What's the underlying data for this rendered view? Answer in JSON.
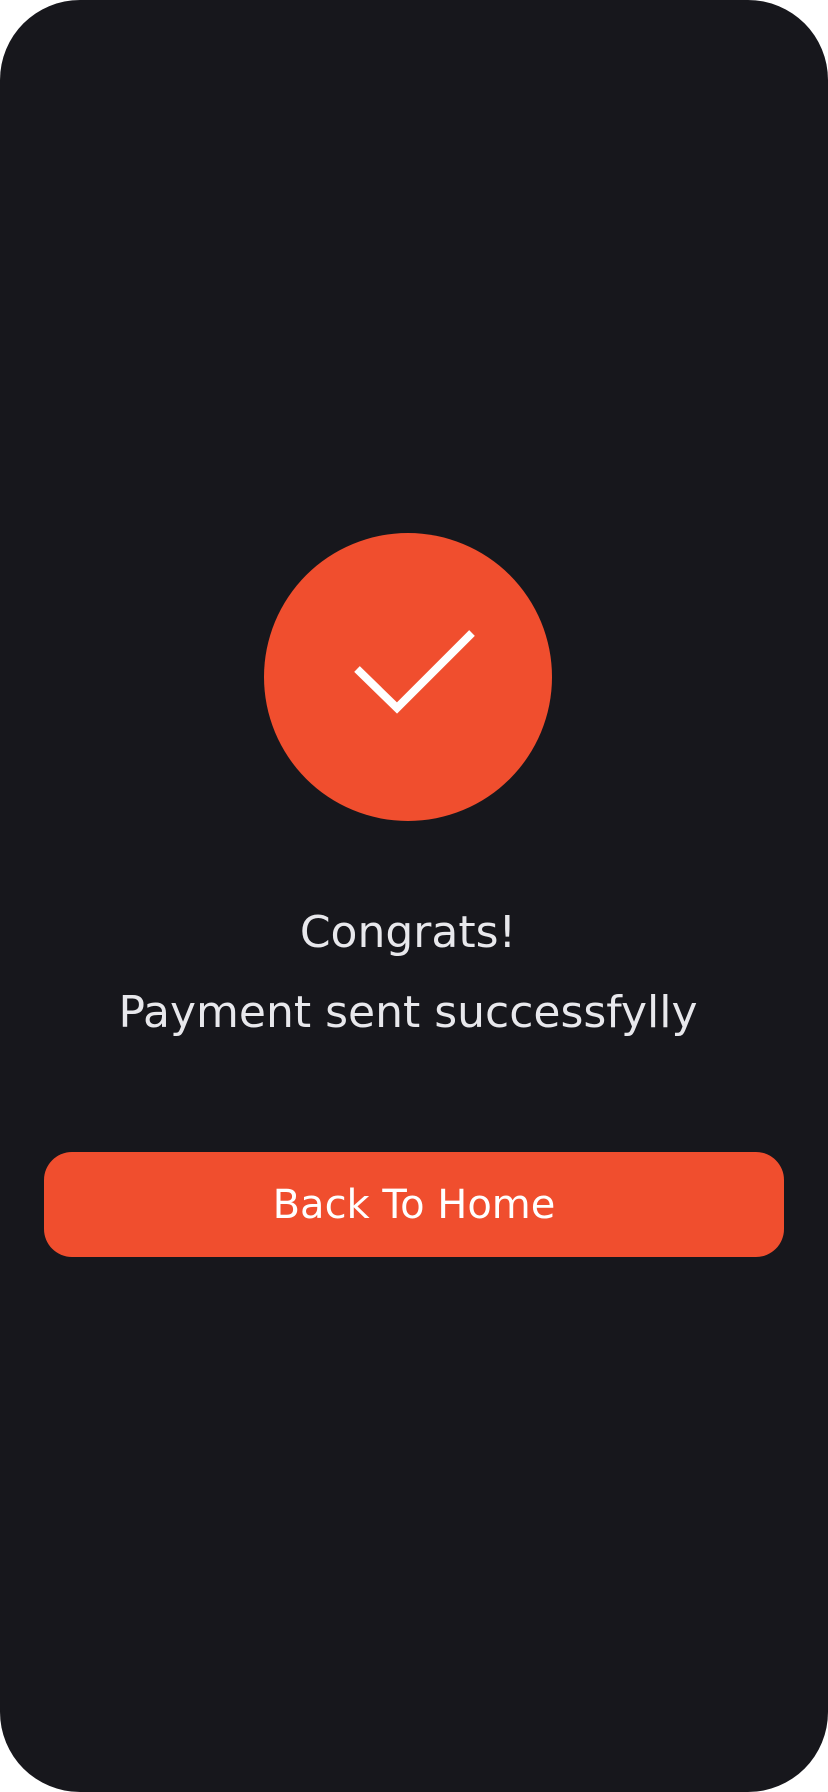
{
  "colors": {
    "background": "#17171c",
    "accent": "#f04e2e",
    "text": "#e8e8ec",
    "button_text": "#ffffff"
  },
  "status_icon": "checkmark-icon",
  "title": "Congrats!",
  "message": "Payment sent successfylly",
  "primary_button": {
    "label": "Back To Home"
  }
}
